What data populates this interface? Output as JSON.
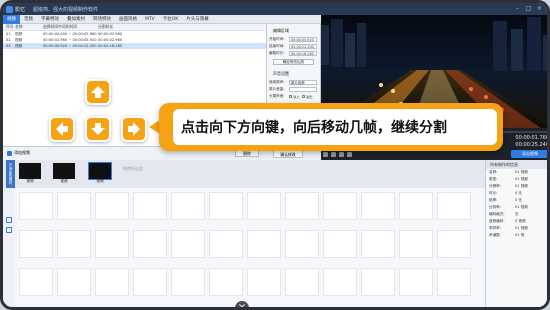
{
  "window": {
    "app_name": "影忆",
    "subtitle": "超级简、强大的视频制作软件"
  },
  "menu": {
    "tabs": [
      "视频",
      "音频",
      "字幕特效",
      "叠加素材",
      "转场特效",
      "画面风格",
      "MTV",
      "卡拉OK",
      "片头与落幕"
    ]
  },
  "clip_table": {
    "headers": [
      "序号",
      "名称",
      "选择时间中间的时间",
      "分割时长"
    ],
    "rows": [
      {
        "id": "01",
        "name": "视频",
        "range": "00:00:00.000 ~ 00:00:02.960",
        "dur": "00:00:02.960"
      },
      {
        "id": "02",
        "name": "视频",
        "range": "00:00:02.960 ~ 00:00:05.920",
        "dur": "00:00:02.960"
      },
      {
        "id": "03",
        "name": "视频",
        "range": "00:00:05.920 ~ 00:00:22.200",
        "dur": "00:00:16.280"
      }
    ]
  },
  "split_panel": {
    "title": "编辑区域",
    "start_label": "开始时间:",
    "start_value": "00:00:05.920",
    "end_label": "结束时间:",
    "end_value": "00:00:22.200",
    "dur_label": "截取时长:",
    "dur_value": "00:00:16.280",
    "confirm_btn": "确定修改后的",
    "audio_title": "声音设置",
    "mode_label": "使用原声:",
    "mode_value": "原片音频",
    "music_label": "原片音量:",
    "fade_label": "头尾声音:",
    "fade_in": "淡入",
    "fade_out": "淡出"
  },
  "bottom_bar": {
    "add_clip": "添加视频",
    "delete_btn": "删除",
    "confirm_btn": "确认修改"
  },
  "player": {
    "progress_pct": 30,
    "speed": "1.0",
    "time_current": "00:00:01.760",
    "time_total": "00:00:25.240",
    "export_btn": "导出视频"
  },
  "timeline": {
    "side_label": "已添加的素材",
    "clips": [
      {
        "label": "视频"
      },
      {
        "label": "视频"
      },
      {
        "label": "视频"
      }
    ],
    "drop_hint": "拖拽到这里"
  },
  "info_panel": {
    "title": "所有制作的信息",
    "rows": [
      {
        "k": "名称:",
        "v": "01 视频"
      },
      {
        "k": "类型:",
        "v": "01 视频"
      },
      {
        "k": "分辨率:",
        "v": "01 视频"
      },
      {
        "k": "时长:",
        "v": "0 无"
      },
      {
        "k": "帧率:",
        "v": "0 无"
      },
      {
        "k": "比特率:",
        "v": "01 视频"
      },
      {
        "k": "编码格式:",
        "v": "无"
      },
      {
        "k": "音频编码:",
        "v": "0 视频"
      },
      {
        "k": "采样率:",
        "v": "01 视频"
      },
      {
        "k": "声道数:",
        "v": "01 音"
      }
    ]
  },
  "overlay": {
    "instruction": "点击向下方向键，向后移动几帧，继续分割",
    "accent": "#f5a314"
  }
}
